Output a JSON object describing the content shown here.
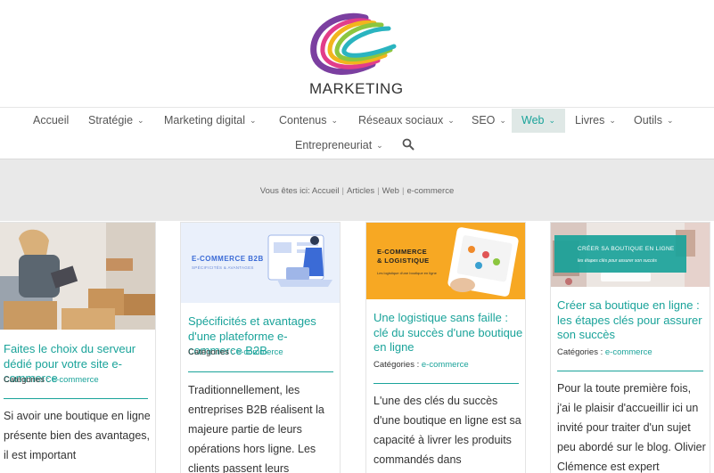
{
  "logo": {
    "text": "MARKETING"
  },
  "nav": {
    "items": [
      {
        "label": "Accueil",
        "has_dropdown": false
      },
      {
        "label": "Stratégie",
        "has_dropdown": true
      },
      {
        "label": "Marketing digital",
        "has_dropdown": true
      },
      {
        "label": "Contenus",
        "has_dropdown": true
      },
      {
        "label": "Réseaux sociaux",
        "has_dropdown": true
      },
      {
        "label": "SEO",
        "has_dropdown": true
      },
      {
        "label": "Web",
        "has_dropdown": true,
        "active": true
      },
      {
        "label": "Livres",
        "has_dropdown": true
      },
      {
        "label": "Outils",
        "has_dropdown": true
      },
      {
        "label": "Entrepreneuriat",
        "has_dropdown": true
      }
    ],
    "search_icon": "search-icon"
  },
  "breadcrumb": {
    "prefix": "Vous êtes ici:",
    "items": [
      "Accueil",
      "Articles",
      "Web",
      "e-commerce"
    ]
  },
  "colors": {
    "accent": "#1aa39a",
    "band": "#e9e9e9",
    "active_nav_bg": "#dfe8e6"
  },
  "cards": [
    {
      "title": "Faites le choix du serveur dédié pour votre site e-commerce",
      "categories_label": "Catégories :",
      "category": "e-commerce",
      "excerpt": "Si avoir une boutique en ligne présente bien des avantages, il est important"
    },
    {
      "image_title": "E-COMMERCE B2B",
      "image_subtitle": "SPÉCIFICITÉS & AVANTAGES",
      "title": "Spécificités et avantages d'une plateforme e-commerce B2B",
      "categories_label": "Catégories :",
      "category": "e-commerce",
      "excerpt": "Traditionnellement, les entreprises B2B réalisent la majeure partie de leurs opérations hors ligne. Les clients passent leurs"
    },
    {
      "image_title_1": "E-COMMERCE",
      "image_title_2": "& LOGISTIQUE",
      "image_subtitle": "Les logistique d'une boutique en ligne",
      "title": "Une logistique sans faille : clé du succès d'une boutique en ligne",
      "categories_label": "Catégories :",
      "category": "e-commerce",
      "excerpt": "L'une des clés du succès d'une boutique en ligne est sa capacité à livrer les produits commandés dans"
    },
    {
      "image_title": "CRÉER SA BOUTIQUE EN LIGNE",
      "image_subtitle": "les étapes clés pour assurer son succès",
      "title": "Créer sa boutique en ligne : les étapes clés pour assurer son succès",
      "categories_label": "Catégories :",
      "category": "e-commerce",
      "excerpt": "Pour la toute première fois, j'ai le plaisir d'accueillir ici un invité pour traiter d'un sujet peu abordé sur le blog. Olivier Clémence est expert"
    }
  ]
}
